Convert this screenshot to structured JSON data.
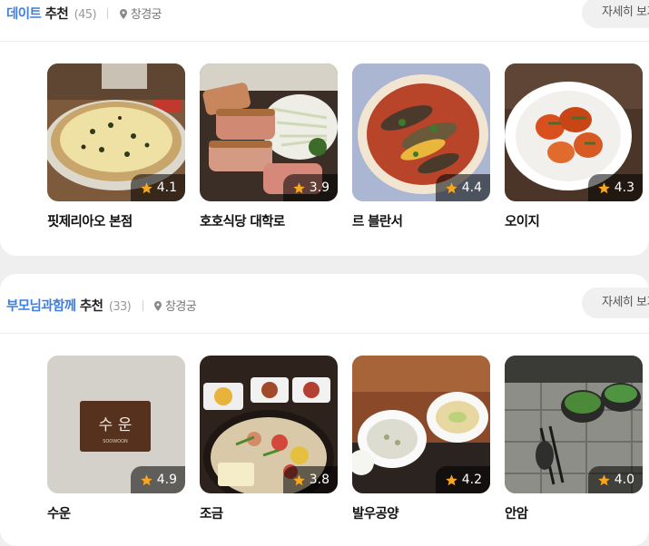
{
  "sections": [
    {
      "title_highlight": "데이트",
      "title_rest": " 추천",
      "count": "(45)",
      "location": "창경궁",
      "more_label": "자세히 보기",
      "places": [
        {
          "name": "핏제리아오 본점",
          "rating": "4.1"
        },
        {
          "name": "호호식당 대학로",
          "rating": "3.9"
        },
        {
          "name": "르 블란서",
          "rating": "4.4"
        },
        {
          "name": "오이지",
          "rating": "4.3"
        }
      ]
    },
    {
      "title_highlight": "부모님과함께",
      "title_rest": " 추천",
      "count": "(33)",
      "location": "창경궁",
      "more_label": "자세히 보기",
      "places": [
        {
          "name": "수운",
          "rating": "4.9",
          "sign_text": "수 운",
          "sign_sub": "SOOWOON"
        },
        {
          "name": "조금",
          "rating": "3.8"
        },
        {
          "name": "발우공양",
          "rating": "4.2"
        },
        {
          "name": "안암",
          "rating": "4.0"
        }
      ]
    }
  ],
  "colors": {
    "accent": "#3d7ee0",
    "star": "#f5a623"
  },
  "icons": {
    "location": "location-pin-icon",
    "rating": "star-icon"
  }
}
